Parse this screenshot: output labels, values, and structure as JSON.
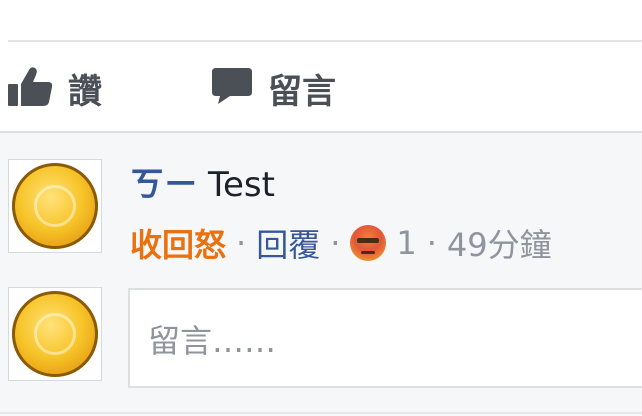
{
  "actions": {
    "like_label": "讚",
    "comment_label": "留言"
  },
  "comment": {
    "author": "ㄎㄧ",
    "text": "Test",
    "reaction_action": "收回怒",
    "reply_label": "回覆",
    "reaction_count": "1",
    "timestamp": "49分鐘",
    "separator": "·"
  },
  "composer": {
    "placeholder": "留言……"
  },
  "colors": {
    "link": "#365899",
    "angry_reaction": "#e9710f",
    "meta_gray": "#90949c"
  },
  "icons": {
    "like": "thumbs-up-icon",
    "comment": "speech-bubble-icon",
    "reaction": "angry-face-icon",
    "avatar": "gold-coin-avatar"
  }
}
